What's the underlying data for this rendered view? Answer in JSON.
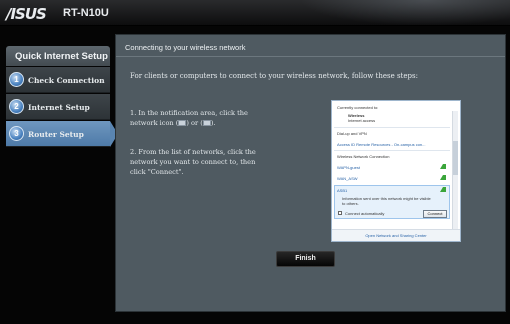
{
  "header": {
    "brand": "/ISUS",
    "model": "RT-N10U"
  },
  "sidebar": {
    "title": "Quick Internet Setup",
    "steps": [
      {
        "num": "1",
        "label": "Check Connection"
      },
      {
        "num": "2",
        "label": "Internet Setup"
      },
      {
        "num": "3",
        "label": "Router Setup"
      }
    ],
    "active_step": 3
  },
  "panel": {
    "title": "Connecting to your wireless network",
    "intro": "For clients or computers to connect to your wireless network, follow these steps:",
    "step1_a": "1. In the notification area, click the",
    "step1_b": "network icon (",
    "step1_c": ") or (",
    "step1_d": ").",
    "step2_a": "2. From the list of networks, click the",
    "step2_b": "network you want to connect to, then",
    "step2_c": "click \"Connect\"."
  },
  "popup": {
    "connected_label": "Currently connected to:",
    "net_name": "Wireless",
    "net_status": "Internet access",
    "dialup": "Dial-up and VPN",
    "remote": "Access ID Remote Resources - On-campus con...",
    "wlan_header": "Wireless Network Connection",
    "net1": "WAPN-guest",
    "net2": "WAN_ASW",
    "net3": "ASB1",
    "warning": "Information sent over this network might be visible to others.",
    "auto_connect": "Connect automatically",
    "connect_btn": "Connect",
    "footer": "Open Network and Sharing Center"
  },
  "actions": {
    "finish": "Finish"
  },
  "colors": {
    "panel_bg": "#4f5a61",
    "active_step": "#5a85b1"
  }
}
